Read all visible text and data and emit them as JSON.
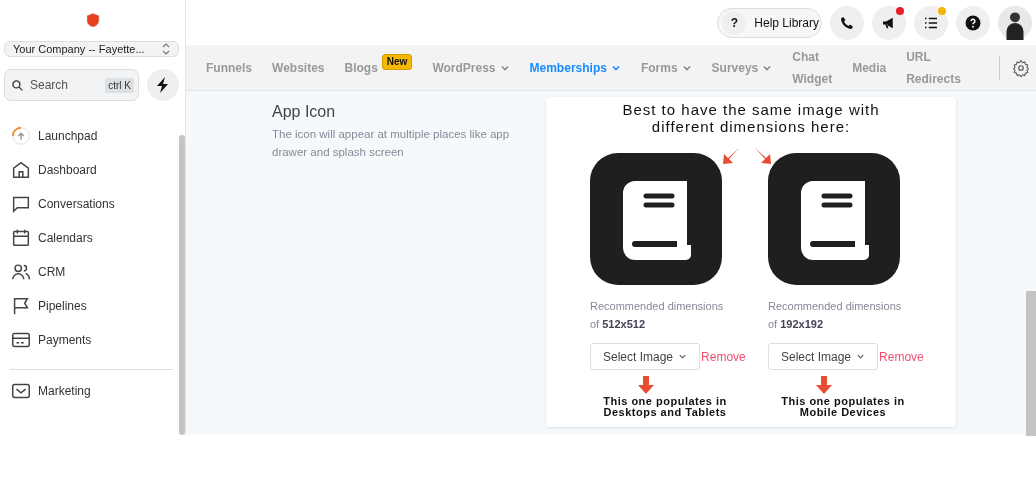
{
  "sidebar": {
    "company": "Your Company -- Fayette...",
    "search": {
      "placeholder": "Search",
      "shortcut": "ctrl K"
    },
    "items": [
      {
        "kind": "launchpad",
        "label": "Launchpad"
      },
      {
        "kind": "home",
        "label": "Dashboard"
      },
      {
        "kind": "chat",
        "label": "Conversations"
      },
      {
        "kind": "calendar",
        "label": "Calendars"
      },
      {
        "kind": "people",
        "label": "CRM"
      },
      {
        "kind": "flag",
        "label": "Pipelines"
      },
      {
        "kind": "card",
        "label": "Payments"
      }
    ],
    "more_items": [
      {
        "kind": "mail",
        "label": "Marketing"
      }
    ]
  },
  "topbar": {
    "help": {
      "mark": "?",
      "label": "Help Library"
    },
    "icons": [
      {
        "kind": "phone"
      },
      {
        "kind": "megaphone",
        "color": "#ee1c25"
      },
      {
        "kind": "list",
        "color": "#f5b400"
      },
      {
        "kind": "help"
      },
      {
        "kind": "avatar"
      }
    ]
  },
  "tabs": [
    {
      "label": "Funnels",
      "selected": false
    },
    {
      "label": "Websites",
      "selected": false
    },
    {
      "label": "Blogs",
      "selected": false,
      "badge": "New"
    },
    {
      "label": "WordPress",
      "selected": false,
      "dropdown": true
    },
    {
      "label": "Memberships",
      "selected": true,
      "dropdown": true
    },
    {
      "label": "Forms",
      "selected": false,
      "dropdown": true
    },
    {
      "label": "Surveys",
      "selected": false,
      "dropdown": true
    },
    {
      "label": "Chat Widget",
      "selected": false
    },
    {
      "label": "Media",
      "selected": false
    },
    {
      "label": "URL Redirects",
      "selected": false
    }
  ],
  "section": {
    "title": "App Icon",
    "description": "The icon will appear at multiple places like app drawer and splash screen"
  },
  "card": {
    "heading": "Best to have the same image with different dimensions here:",
    "icons": [
      {
        "recommended": "Recommended dimensions of **512x512**",
        "button": "Select Image",
        "remove": "Remove",
        "note": "This one populates in Desktops and Tablets"
      },
      {
        "recommended": "Recommended dimensions of **192x192**",
        "button": "Select Image",
        "remove": "Remove",
        "note": "This one populates in Mobile Devices"
      }
    ]
  }
}
